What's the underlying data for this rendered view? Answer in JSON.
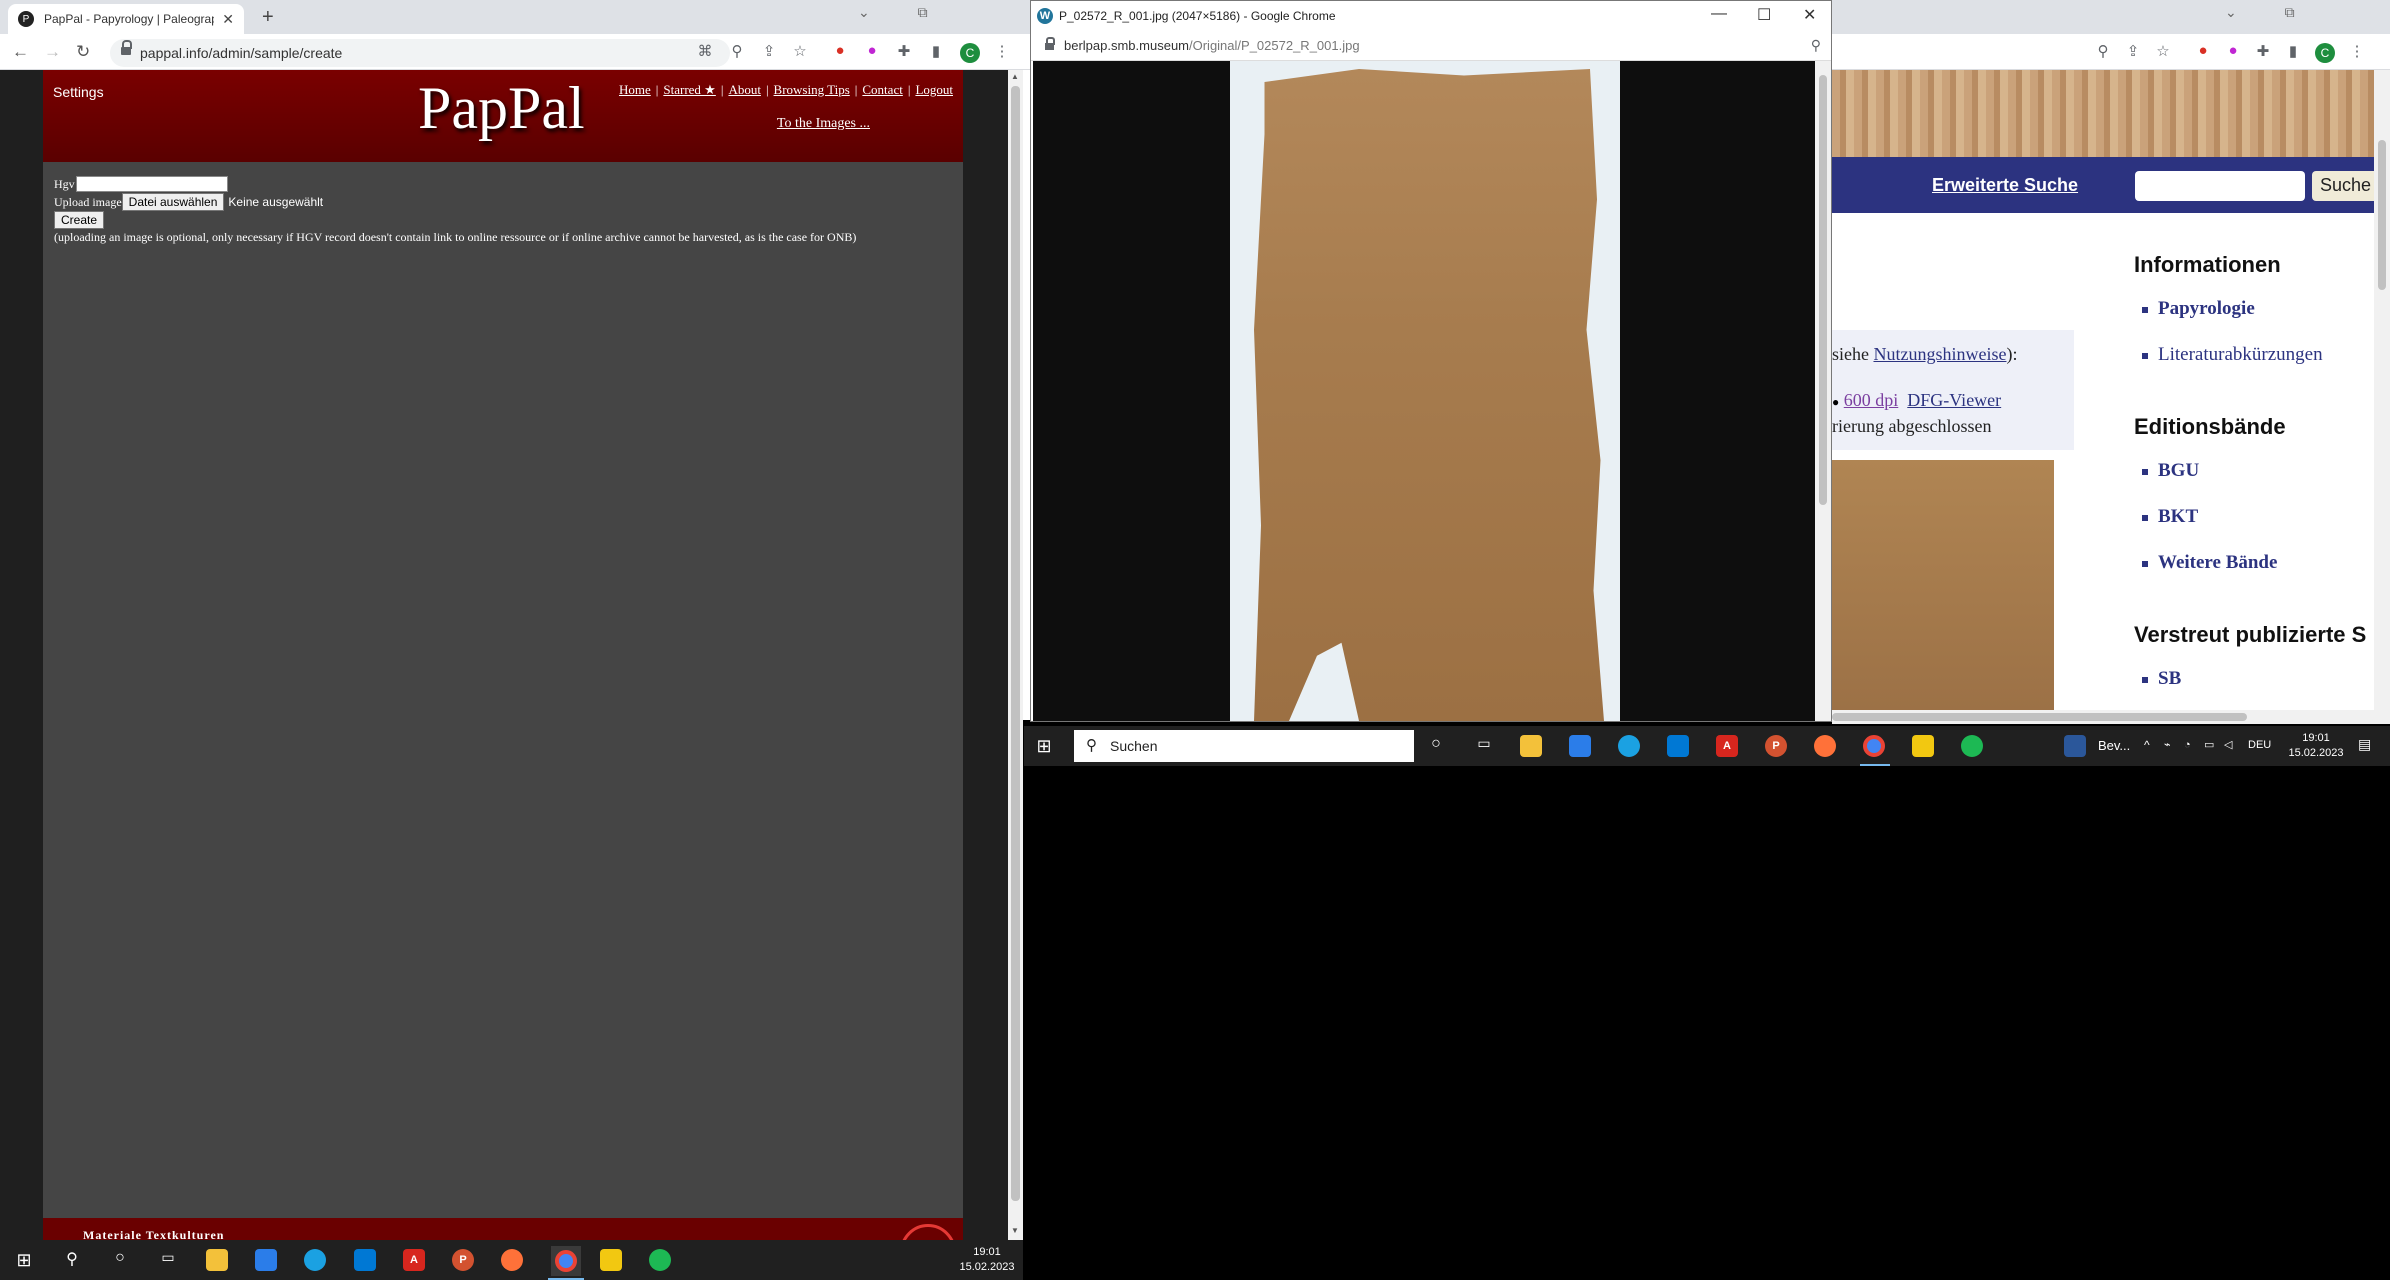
{
  "left_browser": {
    "tab_title": "PapPal - Papyrology | Paleograph",
    "tab_favicon": "P",
    "url": "pappal.info/admin/sample/create",
    "profile_initial": "C"
  },
  "pappal": {
    "settings_label": "Settings",
    "logo": "PapPal",
    "nav": [
      "Home",
      "Starred ★",
      "About",
      "Browsing Tips",
      "Contact",
      "Logout"
    ],
    "to_images": "To the Images ...",
    "form": {
      "hgv_label": "Hgv",
      "hgv_value": "",
      "upload_label": "Upload image",
      "file_button": "Datei auswählen",
      "file_status": "Keine ausgewählt",
      "create_button": "Create",
      "note": "(uploading an image is optional, only necessary if HGV record doesn't contain link to online ressource or if online archive cannot be harvested, as is the case for ONB)"
    },
    "footer_text": "Materiale Textkulturen"
  },
  "popup": {
    "title": "P_02572_R_001.jpg (2047×5186) - Google Chrome",
    "url_domain": "berlpap.smb.museum",
    "url_path": "/Original/P_02572_R_001.jpg"
  },
  "right_browser": {
    "profile_initial": "C",
    "search_link": "Erweiterte Suche",
    "search_button": "Suche",
    "infobox": {
      "line1_prefix": "siehe ",
      "line1_link": "Nutzungshinweise",
      "line1_suffix": "):",
      "dpi_link": "600 dpi",
      "dfg_link": "DFG-Viewer",
      "status": "rierung abgeschlossen"
    },
    "sidebar": {
      "h1": "Informationen",
      "info_items": [
        "Papyrologie",
        "Literaturabkürzungen"
      ],
      "h2": "Editionsbände",
      "edition_items": [
        "BGU",
        "BKT",
        "Weitere Bände"
      ],
      "h3": "Verstreut publizierte S",
      "scattered_items": [
        "SB"
      ]
    }
  },
  "taskbar_small": {
    "search_placeholder": "Suchen",
    "lang": "DEU",
    "time": "19:01",
    "date": "15.02.2023",
    "window_label": "Bev..."
  },
  "taskbar_main": {
    "time": "19:01",
    "date": "15.02.2023"
  },
  "colors": {
    "banner": "#6a0000",
    "page_bg": "#454545",
    "wiki_blue": "#2c3380"
  }
}
